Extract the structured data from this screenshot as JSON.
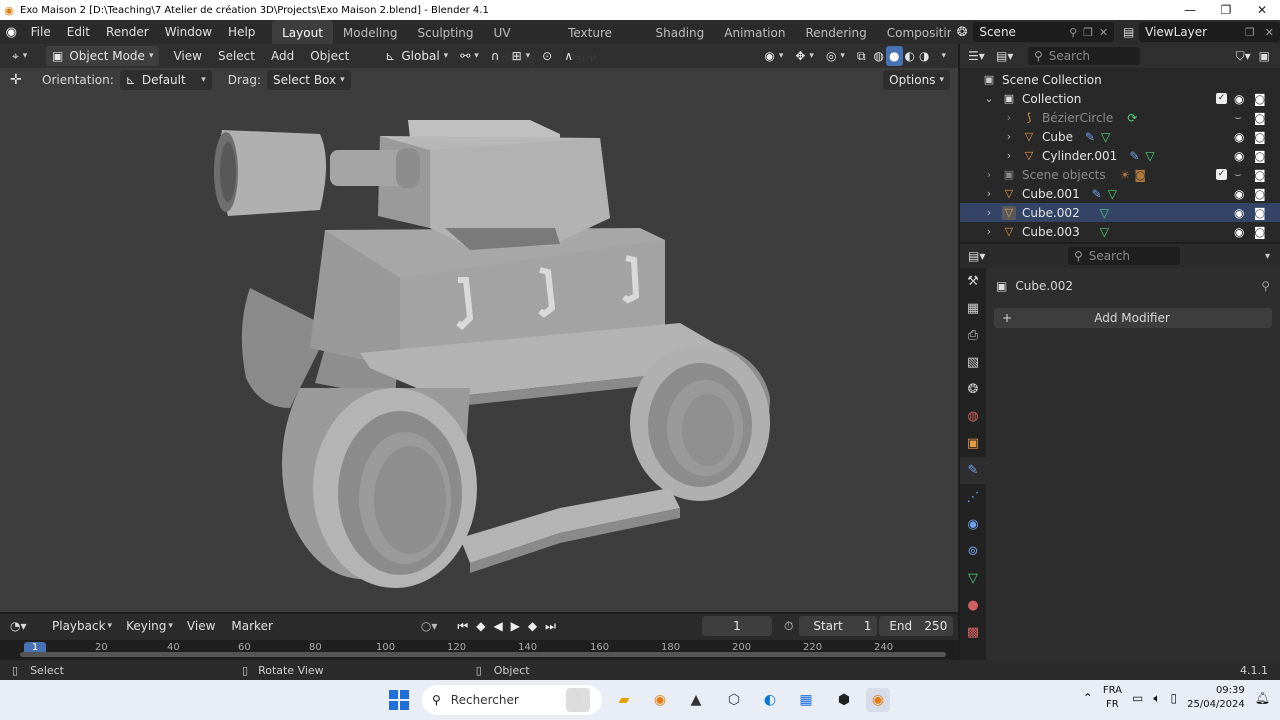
{
  "window": {
    "title": "Exo Maison 2 [D:\\Teaching\\7 Atelier de création 3D\\Projects\\Exo Maison 2.blend] - Blender 4.1"
  },
  "menu": [
    "File",
    "Edit",
    "Render",
    "Window",
    "Help"
  ],
  "workspaces": [
    "Layout",
    "Modeling",
    "Sculpting",
    "UV Editing",
    "Texture Paint",
    "Shading",
    "Animation",
    "Rendering",
    "Compositing"
  ],
  "scene": {
    "name": "Scene"
  },
  "view_layer": {
    "name": "ViewLayer"
  },
  "viewport": {
    "mode": "Object Mode",
    "menus": [
      "View",
      "Select",
      "Add",
      "Object"
    ],
    "transform_orientation": "Global",
    "orientation_label": "Orientation:",
    "orientation_value": "Default",
    "drag_label": "Drag:",
    "drag_value": "Select Box",
    "options_label": "Options"
  },
  "outliner": {
    "search_placeholder": "Search",
    "scene_collection": "Scene Collection",
    "items": [
      {
        "name": "Collection",
        "indent": 1
      },
      {
        "name": "BézierCircle",
        "indent": 2
      },
      {
        "name": "Cube",
        "indent": 2
      },
      {
        "name": "Cylinder.001",
        "indent": 2
      },
      {
        "name": "Scene objects",
        "indent": 1
      },
      {
        "name": "Cube.001",
        "indent": 1
      },
      {
        "name": "Cube.002",
        "indent": 1
      },
      {
        "name": "Cube.003",
        "indent": 1
      }
    ]
  },
  "properties": {
    "search_placeholder": "Search",
    "object_name": "Cube.002",
    "add_modifier_label": "Add Modifier",
    "add_modifier_plus": "+"
  },
  "timeline": {
    "menus": [
      "Playback",
      "Keying",
      "View",
      "Marker"
    ],
    "current_frame": "1",
    "start_label": "Start",
    "start_value": "1",
    "end_label": "End",
    "end_value": "250",
    "ruler_marks": [
      "1",
      "20",
      "40",
      "60",
      "80",
      "100",
      "120",
      "140",
      "160",
      "180",
      "200",
      "220",
      "240"
    ]
  },
  "status": {
    "select": "Select",
    "rotate_view": "Rotate View",
    "object": "Object",
    "version": "4.1.1"
  },
  "taskbar": {
    "search_placeholder": "Rechercher",
    "lang_top": "FRA",
    "lang_bottom": "FR",
    "time": "09:39",
    "date": "25/04/2024"
  },
  "colors": {
    "accent_blue": "#4772b3",
    "object_orange": "#e39b4a",
    "modifier_blue": "#6fa0e8",
    "mesh_green": "#4fd27a"
  }
}
